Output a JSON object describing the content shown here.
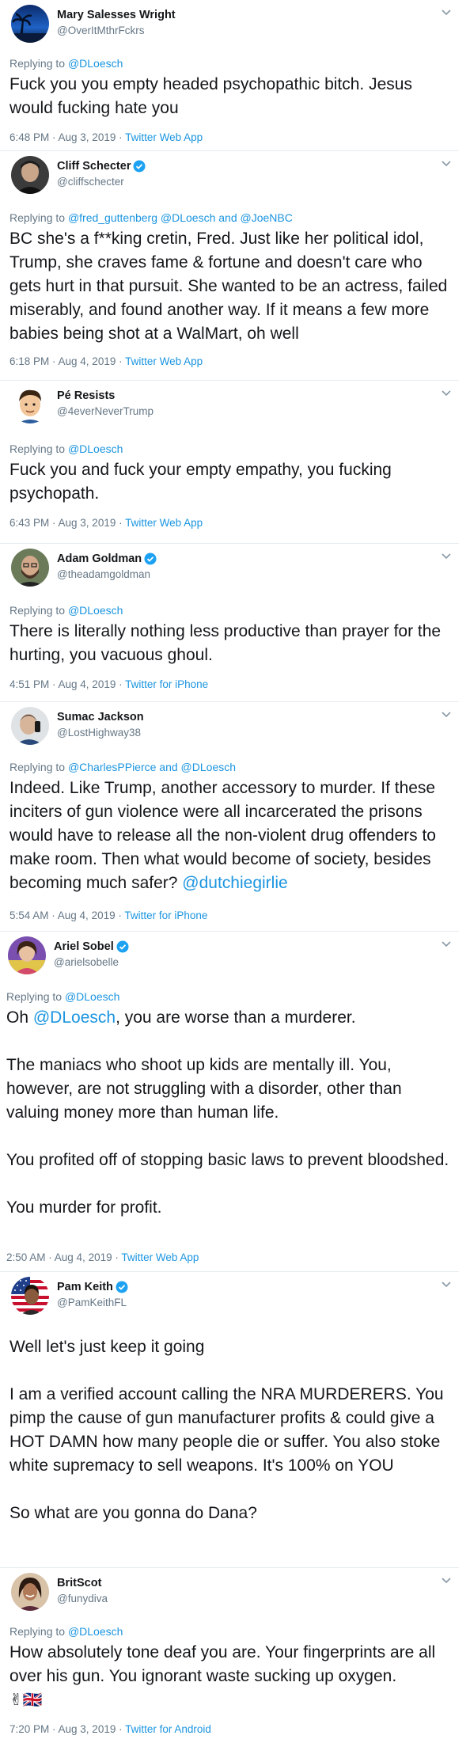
{
  "tweets": [
    {
      "name": "Mary Salesses Wright",
      "handle": "@OverItMthrFckrs",
      "verified": false,
      "reply_prefix": "Replying to ",
      "reply_to": "@DLoesch",
      "text": "Fuck you you empty headed psychopathic bitch. Jesus would fucking hate you",
      "time": "6:48 PM · Aug 3, 2019 · ",
      "source": "Twitter Web App"
    },
    {
      "name": "Cliff Schecter",
      "handle": "@cliffschecter",
      "verified": true,
      "reply_prefix": "Replying to ",
      "reply_to": "@fred_guttenberg @DLoesch and @JoeNBC",
      "text": "BC she's a f**king cretin, Fred. Just like her political idol, Trump, she craves fame & fortune and doesn't care who gets hurt in that pursuit. She wanted to be an actress, failed miserably, and found another way. If it means a few more babies being shot at a WalMart, oh well",
      "time": "6:18 PM · Aug 4, 2019 · ",
      "source": "Twitter Web App"
    },
    {
      "name": "Pé Resists",
      "handle": "@4everNeverTrump",
      "verified": false,
      "reply_prefix": "Replying to ",
      "reply_to": "@DLoesch",
      "text": "Fuck you and fuck your empty empathy, you fucking psychopath.",
      "time": "6:43 PM · Aug 3, 2019 · ",
      "source": "Twitter Web App"
    },
    {
      "name": "Adam Goldman",
      "handle": "@theadamgoldman",
      "verified": true,
      "reply_prefix": "Replying to ",
      "reply_to": "@DLoesch",
      "text": "There is literally nothing less productive than prayer for the hurting, you vacuous ghoul.",
      "time": "4:51 PM · Aug 4, 2019 · ",
      "source": "Twitter for iPhone"
    },
    {
      "name": "Sumac Jackson",
      "handle": "@LostHighway38",
      "verified": false,
      "reply_prefix": "Replying to ",
      "reply_to": "@CharlesPPierce and @DLoesch",
      "text": "Indeed. Like Trump, another accessory to murder. If these inciters of gun violence were all incarcerated the prisons would have to release all the non-violent drug offenders to make room. Then what would become of society, besides becoming much safer? ",
      "text_mention": "@dutchiegirlie",
      "time": "5:54 AM · Aug 4, 2019 · ",
      "source": "Twitter for iPhone"
    },
    {
      "name": "Ariel Sobel",
      "handle": "@arielsobelle",
      "verified": true,
      "reply_prefix": "Replying to ",
      "reply_to": "@DLoesch",
      "text_pre": "Oh ",
      "text_mention": "@DLoesch",
      "text": ", you are worse than a murderer.\n\nThe maniacs who shoot up kids are mentally ill. You, however, are not struggling with a disorder, other than valuing money more than human life.\n\nYou profited off of stopping basic laws to prevent bloodshed.\n\nYou murder for profit.",
      "time": "2:50 AM · Aug 4, 2019 · ",
      "source": "Twitter Web App"
    },
    {
      "name": "Pam Keith",
      "handle": "@PamKeithFL",
      "verified": true,
      "text": "Well let's just keep it going\n\nI am a verified account calling the NRA MURDERERS. You pimp the cause of gun manufacturer profits & could give a HOT DAMN how many people die or suffer. You also stoke white supremacy to sell weapons. It's 100% on YOU\n\nSo what are you gonna do Dana?"
    },
    {
      "name": "BritScot",
      "handle": "@funydiva",
      "verified": false,
      "reply_prefix": "Replying to ",
      "reply_to": "@DLoesch",
      "text": "How absolutely tone deaf you are. Your fingerprints are all over his gun. You ignorant waste sucking up oxygen.",
      "emoji": "✌🇬🇧",
      "time": "7:20 PM · Aug 3, 2019 · ",
      "source": "Twitter for Android"
    }
  ],
  "colors": {
    "text": "#14171a",
    "secondary": "#657786",
    "link": "#1b95e0",
    "verified": "#1da1f2"
  },
  "icons": {
    "caret": "chevron-down-icon",
    "verified": "verified-badge-icon"
  }
}
